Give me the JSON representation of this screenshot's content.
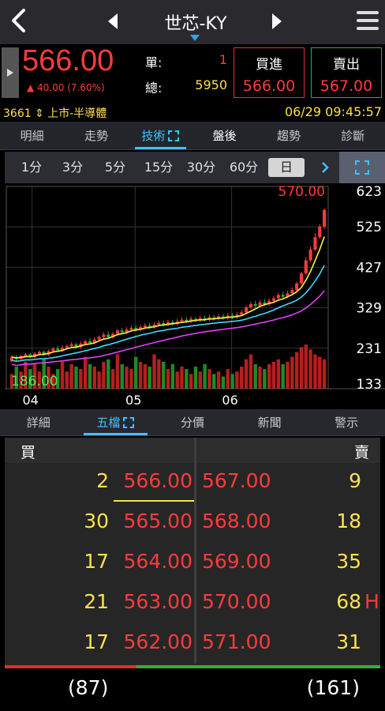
{
  "header": {
    "stock_name": "世芯-KY",
    "icons": {
      "back": "back-chevron-icon",
      "prev": "prev-stock-icon",
      "next": "next-stock-icon",
      "menu": "hamburger-menu-icon",
      "dropdown": "dropdown-caret-icon"
    }
  },
  "quote": {
    "price": "566.00",
    "change": "▲ 40.00 (7.60%)",
    "single_label": "單:",
    "single_volume": "1",
    "total_label": "總:",
    "total_volume": "5950",
    "buy_label": "買進",
    "buy_price": "566.00",
    "sell_label": "賣出",
    "sell_price": "567.00"
  },
  "info": {
    "code_market": "3661 ⇕ 上市-半導體",
    "datetime": "06/29 09:45:57"
  },
  "main_tabs": [
    {
      "label": "明細",
      "active": false
    },
    {
      "label": "走勢",
      "active": false
    },
    {
      "label": "技術",
      "active": true
    },
    {
      "label": "盤後",
      "active": false
    },
    {
      "label": "趨勢",
      "active": false
    },
    {
      "label": "診斷",
      "active": false
    }
  ],
  "periods": [
    {
      "label": "1分",
      "selected": false
    },
    {
      "label": "3分",
      "selected": false
    },
    {
      "label": "5分",
      "selected": false
    },
    {
      "label": "15分",
      "selected": false
    },
    {
      "label": "30分",
      "selected": false
    },
    {
      "label": "60分",
      "selected": false
    },
    {
      "label": "日",
      "selected": true
    }
  ],
  "chart_data": {
    "type": "candlestick",
    "high_label": "570.00",
    "low_label": "186.00",
    "y_ticks": [
      "623",
      "525",
      "427",
      "329",
      "231",
      "133"
    ],
    "ylim": [
      133,
      623
    ],
    "x_ticks": [
      "04",
      "05",
      "06"
    ],
    "moving_average_colors": [
      "#f5f542",
      "#3fd8ff",
      "#e040fb"
    ],
    "candles": [
      [
        200,
        210,
        196,
        214
      ],
      [
        210,
        205,
        200,
        215
      ],
      [
        205,
        212,
        202,
        216
      ],
      [
        212,
        216,
        208,
        220
      ],
      [
        216,
        210,
        206,
        220
      ],
      [
        210,
        218,
        206,
        222
      ],
      [
        218,
        222,
        214,
        226
      ],
      [
        222,
        216,
        212,
        226
      ],
      [
        216,
        224,
        212,
        228
      ],
      [
        224,
        230,
        220,
        234
      ],
      [
        230,
        226,
        222,
        236
      ],
      [
        226,
        232,
        222,
        238
      ],
      [
        232,
        236,
        228,
        240
      ],
      [
        236,
        240,
        232,
        246
      ],
      [
        240,
        234,
        230,
        244
      ],
      [
        234,
        242,
        230,
        248
      ],
      [
        242,
        248,
        238,
        252
      ],
      [
        248,
        244,
        240,
        256
      ],
      [
        244,
        252,
        240,
        258
      ],
      [
        252,
        258,
        248,
        262
      ],
      [
        258,
        264,
        254,
        270
      ],
      [
        264,
        258,
        254,
        272
      ],
      [
        258,
        266,
        254,
        270
      ],
      [
        266,
        274,
        262,
        278
      ],
      [
        274,
        270,
        266,
        280
      ],
      [
        270,
        276,
        266,
        282
      ],
      [
        276,
        280,
        272,
        286
      ],
      [
        280,
        276,
        272,
        286
      ],
      [
        276,
        282,
        272,
        288
      ],
      [
        282,
        286,
        278,
        292
      ],
      [
        286,
        282,
        278,
        292
      ],
      [
        282,
        288,
        278,
        294
      ],
      [
        288,
        292,
        284,
        298
      ],
      [
        292,
        288,
        284,
        298
      ],
      [
        288,
        294,
        284,
        300
      ],
      [
        294,
        290,
        286,
        300
      ],
      [
        290,
        296,
        286,
        302
      ],
      [
        296,
        300,
        292,
        306
      ],
      [
        300,
        296,
        292,
        306
      ],
      [
        296,
        302,
        292,
        308
      ],
      [
        302,
        298,
        294,
        306
      ],
      [
        298,
        304,
        294,
        310
      ],
      [
        304,
        300,
        296,
        310
      ],
      [
        300,
        306,
        296,
        312
      ],
      [
        306,
        302,
        298,
        312
      ],
      [
        302,
        308,
        298,
        314
      ],
      [
        308,
        304,
        300,
        314
      ],
      [
        304,
        310,
        300,
        316
      ],
      [
        310,
        306,
        302,
        316
      ],
      [
        306,
        312,
        302,
        318
      ],
      [
        312,
        318,
        308,
        324
      ],
      [
        318,
        330,
        314,
        334
      ],
      [
        330,
        338,
        326,
        344
      ],
      [
        338,
        334,
        330,
        346
      ],
      [
        334,
        342,
        330,
        348
      ],
      [
        342,
        338,
        334,
        350
      ],
      [
        338,
        346,
        334,
        352
      ],
      [
        346,
        352,
        342,
        358
      ],
      [
        352,
        360,
        348,
        366
      ],
      [
        360,
        356,
        350,
        368
      ],
      [
        356,
        364,
        352,
        370
      ],
      [
        364,
        372,
        360,
        378
      ],
      [
        372,
        388,
        368,
        392
      ],
      [
        388,
        412,
        384,
        416
      ],
      [
        412,
        444,
        408,
        452
      ],
      [
        444,
        470,
        440,
        478
      ],
      [
        470,
        500,
        466,
        510
      ],
      [
        500,
        526,
        496,
        532
      ],
      [
        526,
        566,
        520,
        570
      ]
    ],
    "volume_heights": [
      0.3,
      0.45,
      0.35,
      0.55,
      0.4,
      0.5,
      0.35,
      0.6,
      0.45,
      0.3,
      0.4,
      0.55,
      0.35,
      0.5,
      0.45,
      0.4,
      0.65,
      0.5,
      0.45,
      0.35,
      0.55,
      0.6,
      0.4,
      0.7,
      0.5,
      0.45,
      0.4,
      0.65,
      0.55,
      0.5,
      0.45,
      0.7,
      0.6,
      0.55,
      0.4,
      0.5,
      0.35,
      0.45,
      0.4,
      0.3,
      0.45,
      0.35,
      0.5,
      0.4,
      0.3,
      0.35,
      0.25,
      0.4,
      0.3,
      0.35,
      0.45,
      0.6,
      0.7,
      0.5,
      0.45,
      0.4,
      0.5,
      0.55,
      0.6,
      0.5,
      0.55,
      0.65,
      0.75,
      0.85,
      0.9,
      0.8,
      0.7,
      0.65,
      0.6
    ]
  },
  "book_tabs": [
    {
      "label": "詳細",
      "active": false
    },
    {
      "label": "五檔",
      "active": true
    },
    {
      "label": "分價",
      "active": false
    },
    {
      "label": "新聞",
      "active": false
    },
    {
      "label": "警示",
      "active": false
    }
  ],
  "order_book": {
    "buy_label": "買",
    "sell_label": "賣",
    "rows": [
      {
        "bid_qty": "2",
        "bid_price": "566.00",
        "ask_price": "567.00",
        "ask_qty": "9",
        "flag": ""
      },
      {
        "bid_qty": "30",
        "bid_price": "565.00",
        "ask_price": "568.00",
        "ask_qty": "18",
        "flag": ""
      },
      {
        "bid_qty": "17",
        "bid_price": "564.00",
        "ask_price": "569.00",
        "ask_qty": "35",
        "flag": ""
      },
      {
        "bid_qty": "21",
        "bid_price": "563.00",
        "ask_price": "570.00",
        "ask_qty": "68",
        "flag": "H"
      },
      {
        "bid_qty": "17",
        "bid_price": "562.00",
        "ask_price": "571.00",
        "ask_qty": "31",
        "flag": ""
      }
    ],
    "buy_total": "(87)",
    "sell_total": "(161)",
    "buy_ratio": 0.35
  },
  "colors": {
    "up": "#ff3b3b",
    "down": "#2fb03a",
    "accent": "#3fc1ff",
    "quantity": "#ffe14a"
  }
}
